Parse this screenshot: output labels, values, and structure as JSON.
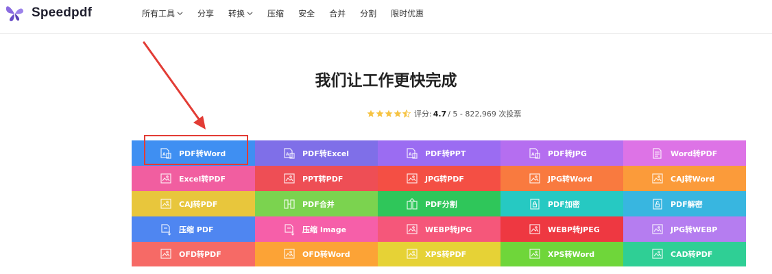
{
  "brand": {
    "name": "Speedpdf"
  },
  "nav": [
    {
      "label": "所有工具",
      "dropdown": true
    },
    {
      "label": "分享",
      "dropdown": false
    },
    {
      "label": "转换",
      "dropdown": true
    },
    {
      "label": "压缩",
      "dropdown": false
    },
    {
      "label": "安全",
      "dropdown": false
    },
    {
      "label": "合并",
      "dropdown": false
    },
    {
      "label": "分割",
      "dropdown": false
    },
    {
      "label": "限时优惠",
      "dropdown": false
    }
  ],
  "hero": {
    "title": "我们让工作更快完成",
    "rating_prefix": "评分:",
    "rating_value": "4.7",
    "rating_suffix": "/ 5 - 822,969 次投票",
    "stars": 4.5
  },
  "tools": [
    {
      "label": "PDF转Word",
      "color": "#3f8ff2",
      "icon": "pdf-doc-icon"
    },
    {
      "label": "PDF转Excel",
      "color": "#7f6fe8",
      "icon": "pdf-doc-icon"
    },
    {
      "label": "PDF转PPT",
      "color": "#9b6cf2",
      "icon": "pdf-doc-icon"
    },
    {
      "label": "PDF转JPG",
      "color": "#b56ef0",
      "icon": "pdf-doc-icon"
    },
    {
      "label": "Word转PDF",
      "color": "#dd73e6",
      "icon": "doc-icon"
    },
    {
      "label": "Excel转PDF",
      "color": "#f15ea0",
      "icon": "image-doc-icon"
    },
    {
      "label": "PPT转PDF",
      "color": "#ee4e55",
      "icon": "image-doc-icon"
    },
    {
      "label": "JPG转PDF",
      "color": "#f44f44",
      "icon": "image-doc-icon"
    },
    {
      "label": "JPG转Word",
      "color": "#f97a3f",
      "icon": "image-doc-icon"
    },
    {
      "label": "CAJ转Word",
      "color": "#fb9b3a",
      "icon": "image-doc-icon"
    },
    {
      "label": "CAJ转PDF",
      "color": "#e8c63c",
      "icon": "image-doc-icon"
    },
    {
      "label": "PDF合并",
      "color": "#7bd34f",
      "icon": "merge-icon"
    },
    {
      "label": "PDF分割",
      "color": "#2fc65a",
      "icon": "split-icon"
    },
    {
      "label": "PDF加密",
      "color": "#26c9c2",
      "icon": "lock-icon"
    },
    {
      "label": "PDF解密",
      "color": "#38b6e0",
      "icon": "unlock-icon"
    },
    {
      "label": "压缩 PDF",
      "color": "#4f86f1",
      "icon": "compress-icon"
    },
    {
      "label": "压缩 Image",
      "color": "#f65fa9",
      "icon": "compress-icon"
    },
    {
      "label": "WEBP转JPG",
      "color": "#f5577a",
      "icon": "image-doc-icon"
    },
    {
      "label": "WEBP转JPEG",
      "color": "#ee3841",
      "icon": "image-doc-icon"
    },
    {
      "label": "JPG转WEBP",
      "color": "#b57df0",
      "icon": "image-doc-icon"
    },
    {
      "label": "OFD转PDF",
      "color": "#f66a66",
      "icon": "image-doc-icon"
    },
    {
      "label": "OFD转Word",
      "color": "#fca336",
      "icon": "image-doc-icon"
    },
    {
      "label": "XPS转PDF",
      "color": "#e6d236",
      "icon": "image-doc-icon"
    },
    {
      "label": "XPS转Word",
      "color": "#6fd63a",
      "icon": "image-doc-icon"
    },
    {
      "label": "CAD转PDF",
      "color": "#2fcf95",
      "icon": "image-doc-icon"
    }
  ],
  "colors": {
    "annotation_red": "#e23c35",
    "star": "#f6c342",
    "brand_purple": "#7b5bd6"
  }
}
